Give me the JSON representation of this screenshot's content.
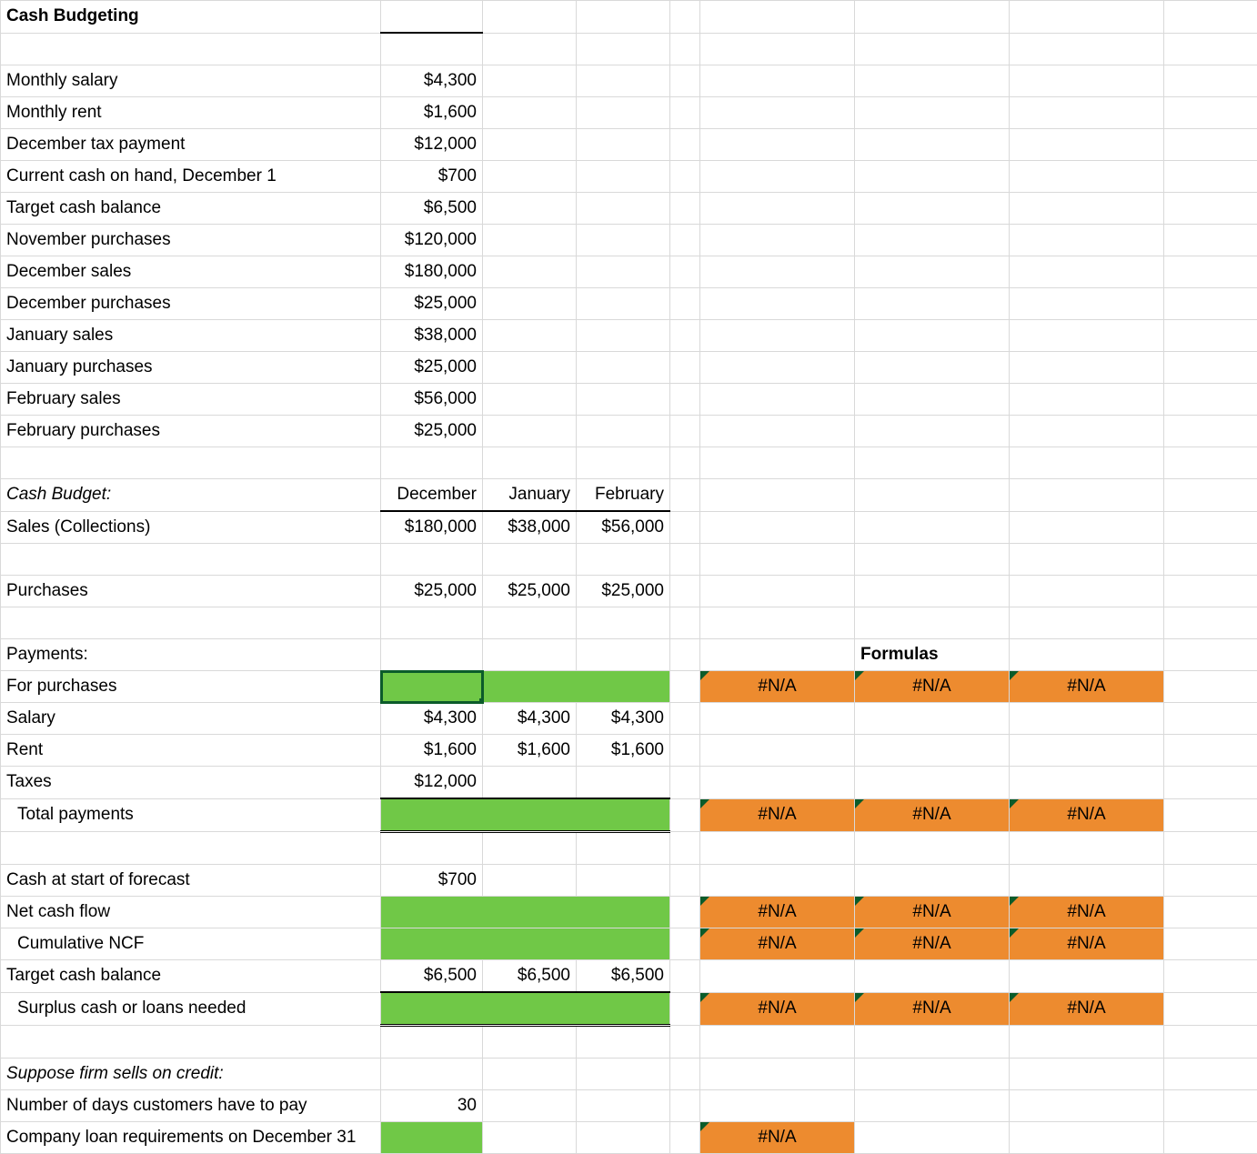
{
  "title": "Cash Budgeting",
  "inputs": {
    "monthly_salary": {
      "label": "Monthly salary",
      "value": "$4,300"
    },
    "monthly_rent": {
      "label": "Monthly rent",
      "value": "$1,600"
    },
    "december_tax": {
      "label": "December tax payment",
      "value": "$12,000"
    },
    "cash_on_hand": {
      "label": "Current cash on hand, December 1",
      "value": "$700"
    },
    "target_cash": {
      "label": "Target cash balance",
      "value": "$6,500"
    },
    "nov_purchases": {
      "label": "November purchases",
      "value": "$120,000"
    },
    "dec_sales": {
      "label": "December sales",
      "value": "$180,000"
    },
    "dec_purchases": {
      "label": "December purchases",
      "value": "$25,000"
    },
    "jan_sales": {
      "label": "January sales",
      "value": "$38,000"
    },
    "jan_purchases": {
      "label": "January purchases",
      "value": "$25,000"
    },
    "feb_sales": {
      "label": "February sales",
      "value": "$56,000"
    },
    "feb_purchases": {
      "label": "February purchases",
      "value": "$25,000"
    }
  },
  "budget": {
    "heading": "Cash Budget:",
    "months": {
      "dec": "December",
      "jan": "January",
      "feb": "February"
    },
    "sales": {
      "label": "Sales (Collections)",
      "dec": "$180,000",
      "jan": "$38,000",
      "feb": "$56,000"
    },
    "purch": {
      "label": "Purchases",
      "dec": "$25,000",
      "jan": "$25,000",
      "feb": "$25,000"
    },
    "payments_heading": "Payments:",
    "formulas_heading": "Formulas",
    "for_purchases": {
      "label": "For purchases",
      "e1": "#N/A",
      "e2": "#N/A",
      "e3": "#N/A"
    },
    "salary": {
      "label": "Salary",
      "dec": "$4,300",
      "jan": "$4,300",
      "feb": "$4,300"
    },
    "rent": {
      "label": "Rent",
      "dec": "$1,600",
      "jan": "$1,600",
      "feb": "$1,600"
    },
    "taxes": {
      "label": "Taxes",
      "dec": "$12,000"
    },
    "total_payments": {
      "label": "Total payments",
      "e1": "#N/A",
      "e2": "#N/A",
      "e3": "#N/A"
    },
    "cash_start": {
      "label": "Cash at start of forecast",
      "dec": "$700"
    },
    "ncf": {
      "label": "Net cash flow",
      "e1": "#N/A",
      "e2": "#N/A",
      "e3": "#N/A"
    },
    "cncf": {
      "label": "Cumulative NCF",
      "e1": "#N/A",
      "e2": "#N/A",
      "e3": "#N/A"
    },
    "target": {
      "label": "Target cash balance",
      "dec": "$6,500",
      "jan": "$6,500",
      "feb": "$6,500"
    },
    "surplus": {
      "label": "Surplus cash or loans needed",
      "e1": "#N/A",
      "e2": "#N/A",
      "e3": "#N/A"
    }
  },
  "credit": {
    "heading": "Suppose firm sells on credit:",
    "days": {
      "label": "Number of days customers have to pay",
      "value": "30"
    },
    "loan": {
      "label": "Company loan requirements on December 31",
      "e1": "#N/A"
    }
  }
}
